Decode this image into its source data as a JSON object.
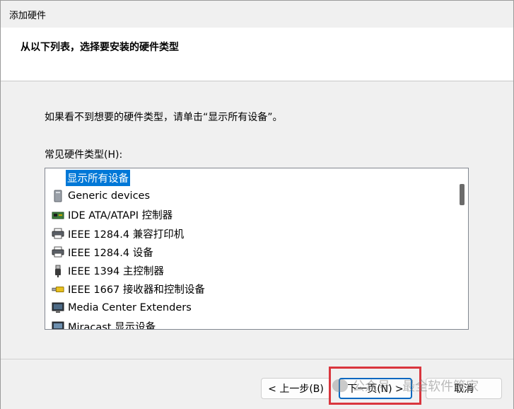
{
  "window": {
    "title": "添加硬件"
  },
  "header": {
    "heading": "从以下列表，选择要安装的硬件类型"
  },
  "body": {
    "hint": "如果看不到想要的硬件类型，请单击“显示所有设备”。",
    "list_label": "常见硬件类型(H):",
    "items": [
      {
        "label": "显示所有设备",
        "icon": "none",
        "selected": true
      },
      {
        "label": "Generic devices",
        "icon": "generic-device-icon"
      },
      {
        "label": "IDE ATA/ATAPI 控制器",
        "icon": "ide-controller-icon"
      },
      {
        "label": "IEEE 1284.4 兼容打印机",
        "icon": "printer-icon"
      },
      {
        "label": "IEEE 1284.4 设备",
        "icon": "printer-icon"
      },
      {
        "label": "IEEE 1394 主控制器",
        "icon": "usb-plug-icon"
      },
      {
        "label": "IEEE 1667 接收器和控制设备",
        "icon": "usb-drive-icon"
      },
      {
        "label": "Media Center Extenders",
        "icon": "monitor-icon"
      },
      {
        "label": "Miracast 显示设备",
        "icon": "monitor-icon"
      }
    ]
  },
  "footer": {
    "back_label": "< 上一步(B)",
    "next_label": "下一页(N) >",
    "cancel_label": "取消"
  },
  "watermark": {
    "text": "公众号 · 最全软件管家"
  },
  "colors": {
    "selection": "#0078d7",
    "highlight_box": "#d9363e",
    "default_button_border": "#0067c0"
  }
}
